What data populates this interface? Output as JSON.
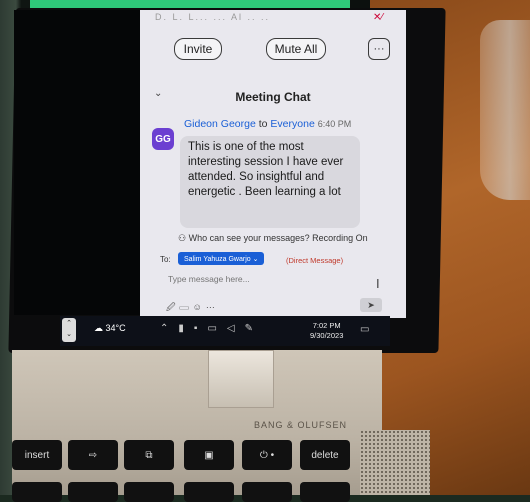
{
  "meeting": {
    "top_faint": "D. L. L... ... Al .. ..",
    "invite_label": "Invite",
    "mute_all_label": "Mute All",
    "more_label": "···",
    "chat_title": "Meeting Chat",
    "sender_name": "Gideon George",
    "to_word": "to",
    "to_target": "Everyone",
    "time": "6:40 PM",
    "avatar_initials": "GG",
    "message": "This is one of the most interesting session I have ever attended. So insightful and energetic . Been learning a lot",
    "who_can_see": "Who can see your messages? Recording On",
    "to_label": "To:",
    "recipient": "Salim Yahuza Gwarjo ⌄",
    "direct_message": "(Direct Message)",
    "input_placeholder": "Type message here..."
  },
  "taskbar": {
    "weather": "34°C",
    "clock_time": "7:02 PM",
    "clock_date": "9/30/2023"
  },
  "laptop": {
    "brand": "BANG & OLUFSEN",
    "keys": [
      "insert",
      "",
      "",
      "",
      "",
      "delete"
    ]
  },
  "colors": {
    "accent": "#1a5fd6",
    "avatar": "#6b3fd1",
    "direct_message": "#c0392b"
  }
}
